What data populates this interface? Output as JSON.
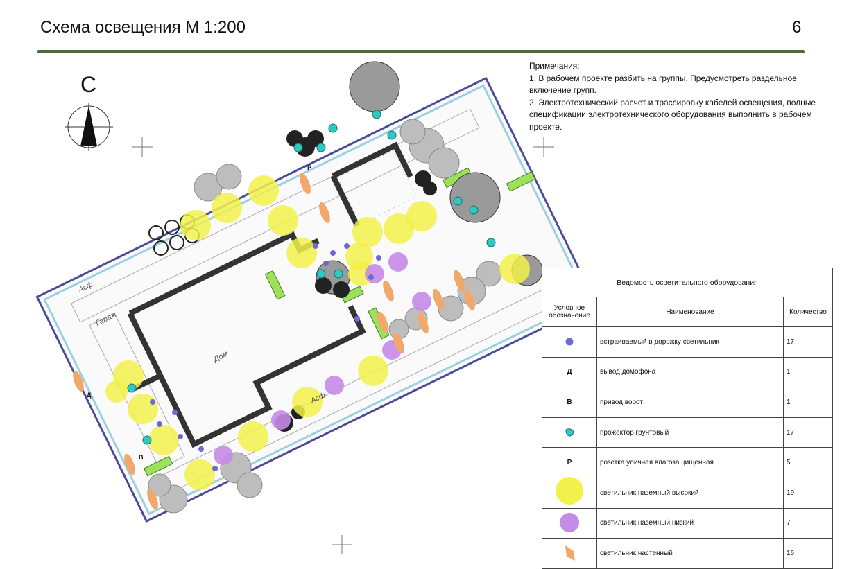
{
  "header": {
    "title": "Схема освещения М 1:200",
    "page_number": "6"
  },
  "north": {
    "letter": "С"
  },
  "notes": {
    "heading": "Примечания:",
    "items": [
      "1. В рабочем проекте разбить на группы. Предусмотреть раздельное включение групп.",
      "2. Электротехнический расчет и трассировку кабелей освещения, полные спецификации электротехнического оборудования выполнить в рабочем проекте."
    ]
  },
  "plan": {
    "labels": {
      "garage": "Гараж",
      "house": "Дом",
      "asphalt1": "Асф.",
      "asphalt2": "Асф."
    },
    "markers": {
      "d": "Д",
      "v": "В",
      "p": "Р"
    }
  },
  "legend": {
    "caption": "Ведомость осветительного оборудования",
    "headers": {
      "symbol": "Условное обозначение",
      "name": "Наименование",
      "qty": "Количество"
    },
    "rows": [
      {
        "symbol": "blue-dot",
        "symbol_text": "",
        "name": "встраиваемый в дорожку светильник",
        "qty": "17"
      },
      {
        "symbol": "letter",
        "symbol_text": "Д",
        "name": "вывод домофона",
        "qty": "1"
      },
      {
        "symbol": "letter",
        "symbol_text": "В",
        "name": "привод ворот",
        "qty": "1"
      },
      {
        "symbol": "teal-blob",
        "symbol_text": "",
        "name": "прожектор грунтовый",
        "qty": "17"
      },
      {
        "symbol": "letter",
        "symbol_text": "Р",
        "name": "розетка уличная влагозащищенная",
        "qty": "5"
      },
      {
        "symbol": "yellow-circle",
        "symbol_text": "",
        "name": "светильник наземный высокий",
        "qty": "19"
      },
      {
        "symbol": "purple-circle",
        "symbol_text": "",
        "name": "светильник наземный низкий",
        "qty": "7"
      },
      {
        "symbol": "orange-shape",
        "symbol_text": "",
        "name": "светильник настенный",
        "qty": "16"
      }
    ]
  },
  "colors": {
    "rule": "#4b6b3c",
    "yellow": "#f2f04a",
    "purple": "#c58be8",
    "blue": "#6a6ad8",
    "teal": "#2ec9c4",
    "orange": "#f2a86a",
    "green": "#9ee05a",
    "wall": "#3a3a3a"
  }
}
